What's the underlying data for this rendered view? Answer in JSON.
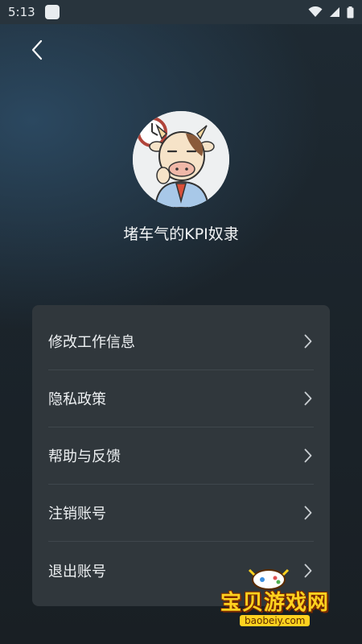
{
  "status_bar": {
    "time": "5:13",
    "icons": [
      "notification-icon",
      "wifi-icon",
      "signal-icon",
      "battery-icon"
    ]
  },
  "header": {
    "back_icon": "chevron-left-icon"
  },
  "profile": {
    "username": "堵车气的KPI奴隶",
    "avatar": "cartoon-cow-avatar"
  },
  "menu": {
    "items": [
      {
        "label": "修改工作信息"
      },
      {
        "label": "隐私政策"
      },
      {
        "label": "帮助与反馈"
      },
      {
        "label": "注销账号"
      },
      {
        "label": "退出账号"
      }
    ]
  },
  "watermark": {
    "text": "宝贝游戏网",
    "url": "baobeiy.com"
  },
  "colors": {
    "background": "#1b2127",
    "card": "#30373c",
    "text": "#eef1f3",
    "watermark": "#ffd21f"
  }
}
